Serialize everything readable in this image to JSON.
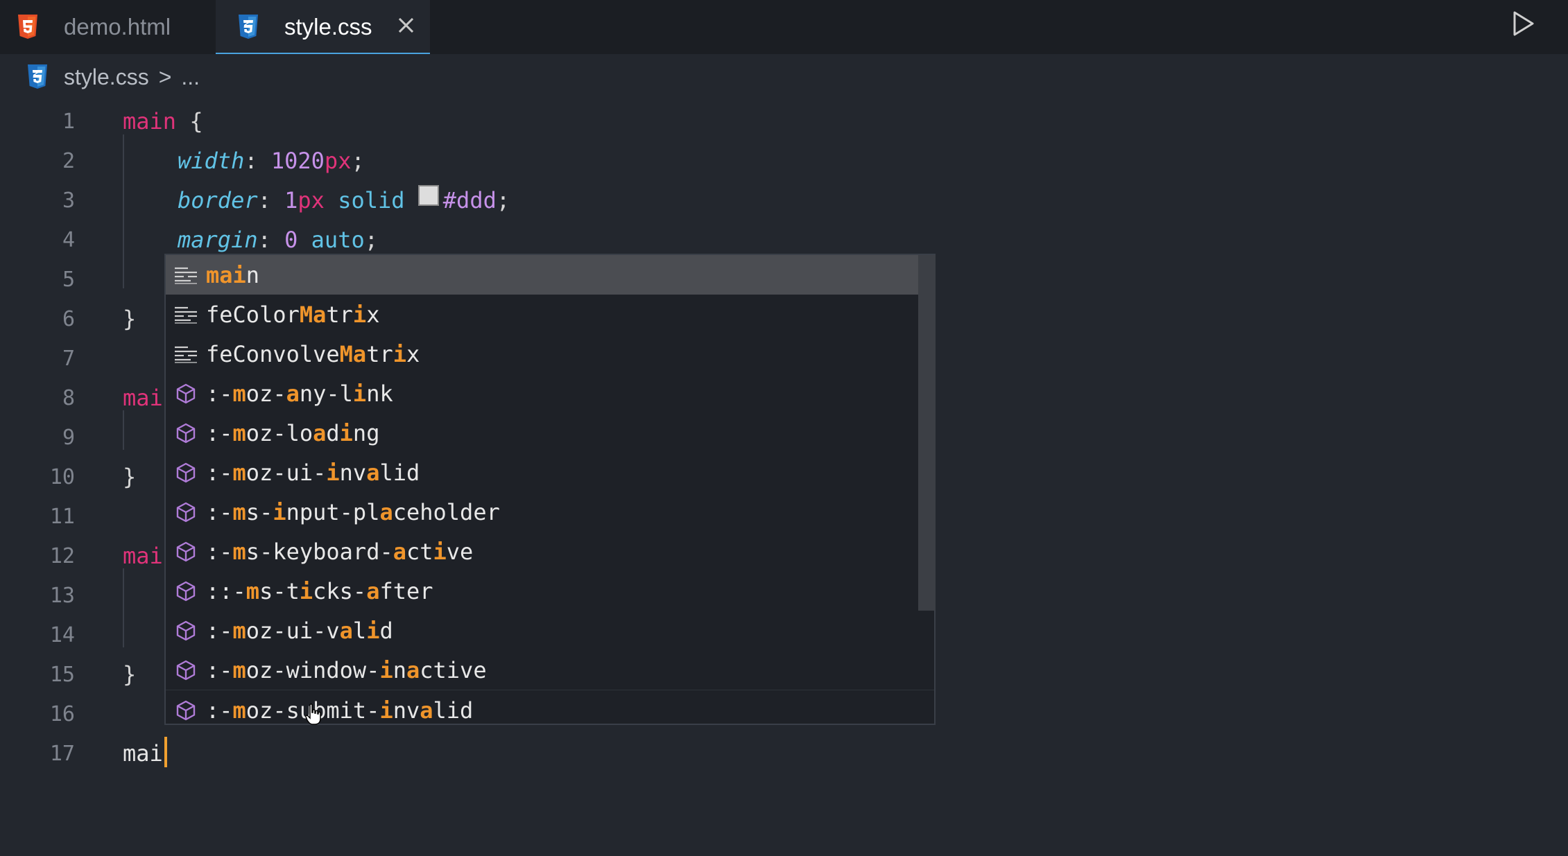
{
  "tabs": [
    {
      "label": "demo.html",
      "icon": "html5-icon",
      "color": "#e44d26"
    },
    {
      "label": "style.css",
      "icon": "css3-icon",
      "color": "#2a7fcf",
      "active": true
    }
  ],
  "breadcrumb": {
    "file": "style.css",
    "separator": ">",
    "rest": "..."
  },
  "line_numbers": [
    "1",
    "2",
    "3",
    "4",
    "5",
    "6",
    "7",
    "8",
    "9",
    "10",
    "11",
    "12",
    "13",
    "14",
    "15",
    "16",
    "17"
  ],
  "code": {
    "l1_sel": "main",
    "l1_brace": "{",
    "l2_prop": "width",
    "l2_colon": ": ",
    "l2_num": "1020",
    "l2_unit": "px",
    "l2_semi": ";",
    "l3_prop": "border",
    "l3_colon": ": ",
    "l3_num": "1",
    "l3_unit": "px",
    "l3_kw": "solid",
    "l3_color": "#ddd",
    "l3_semi": ";",
    "l4_prop": "margin",
    "l4_colon": ": ",
    "l4_num": "0",
    "l4_kw": "auto",
    "l4_semi": ";",
    "l6_brace": "}",
    "l8_sel": "mai",
    "l10_brace": "}",
    "l12_sel": "mai",
    "l15_brace": "}",
    "l17_text": "mai"
  },
  "suggestions": [
    {
      "kind": "snippet",
      "parts": [
        [
          "ma",
          1
        ],
        [
          "i",
          1
        ],
        [
          "n",
          0
        ]
      ]
    },
    {
      "kind": "snippet",
      "parts": [
        [
          "feColor",
          0
        ],
        [
          "Ma",
          1
        ],
        [
          "tr",
          0
        ],
        [
          "i",
          1
        ],
        [
          "x",
          0
        ]
      ]
    },
    {
      "kind": "snippet",
      "parts": [
        [
          "feConvolve",
          0
        ],
        [
          "Ma",
          1
        ],
        [
          "tr",
          0
        ],
        [
          "i",
          1
        ],
        [
          "x",
          0
        ]
      ]
    },
    {
      "kind": "property",
      "parts": [
        [
          ":-",
          0
        ],
        [
          "m",
          1
        ],
        [
          "oz-",
          0
        ],
        [
          "a",
          1
        ],
        [
          "ny-l",
          0
        ],
        [
          "i",
          1
        ],
        [
          "nk",
          0
        ]
      ]
    },
    {
      "kind": "property",
      "parts": [
        [
          ":-",
          0
        ],
        [
          "m",
          1
        ],
        [
          "oz-lo",
          0
        ],
        [
          "a",
          1
        ],
        [
          "d",
          0
        ],
        [
          "i",
          1
        ],
        [
          "ng",
          0
        ]
      ]
    },
    {
      "kind": "property",
      "parts": [
        [
          ":-",
          0
        ],
        [
          "m",
          1
        ],
        [
          "oz-ui-",
          0
        ],
        [
          "i",
          1
        ],
        [
          "nv",
          0
        ],
        [
          "a",
          1
        ],
        [
          "lid",
          0
        ]
      ]
    },
    {
      "kind": "property",
      "parts": [
        [
          ":-",
          0
        ],
        [
          "m",
          1
        ],
        [
          "s-",
          0
        ],
        [
          "i",
          1
        ],
        [
          "nput-pl",
          0
        ],
        [
          "a",
          1
        ],
        [
          "ceholder",
          0
        ]
      ]
    },
    {
      "kind": "property",
      "parts": [
        [
          ":-",
          0
        ],
        [
          "m",
          1
        ],
        [
          "s-keyboard-",
          0
        ],
        [
          "a",
          1
        ],
        [
          "ct",
          0
        ],
        [
          "i",
          1
        ],
        [
          "ve",
          0
        ]
      ]
    },
    {
      "kind": "property",
      "parts": [
        [
          "::-",
          0
        ],
        [
          "m",
          1
        ],
        [
          "s-t",
          0
        ],
        [
          "i",
          1
        ],
        [
          "cks-",
          0
        ],
        [
          "a",
          1
        ],
        [
          "fter",
          0
        ]
      ]
    },
    {
      "kind": "property",
      "parts": [
        [
          ":-",
          0
        ],
        [
          "m",
          1
        ],
        [
          "oz-ui-v",
          0
        ],
        [
          "a",
          1
        ],
        [
          "l",
          0
        ],
        [
          "i",
          1
        ],
        [
          "d",
          0
        ]
      ]
    },
    {
      "kind": "property",
      "parts": [
        [
          ":-",
          0
        ],
        [
          "m",
          1
        ],
        [
          "oz-window-",
          0
        ],
        [
          "i",
          1
        ],
        [
          "n",
          0
        ],
        [
          "a",
          1
        ],
        [
          "ctive",
          0
        ]
      ]
    },
    {
      "kind": "property",
      "parts": [
        [
          ":-",
          0
        ],
        [
          "m",
          1
        ],
        [
          "oz-submit-",
          0
        ],
        [
          "i",
          1
        ],
        [
          "nv",
          0
        ],
        [
          "a",
          1
        ],
        [
          "lid",
          0
        ]
      ]
    }
  ],
  "colors": {
    "accent_underline": "#4aa3df",
    "caret": "#f0a030",
    "match_highlight": "#f0952b",
    "property_icon": "#b07cd8"
  }
}
